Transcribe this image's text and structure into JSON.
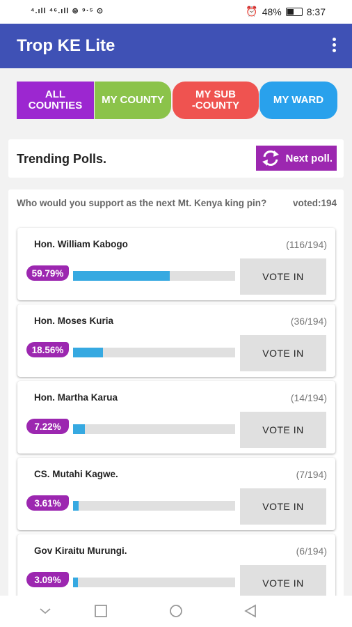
{
  "status_bar": {
    "left": "⁴.ıll ⁴⁶.ıll ⊚ ⁹·⁵ ⊙",
    "battery": "48%",
    "time": "8:37"
  },
  "app": {
    "title": "Trop KE Lite"
  },
  "filters": [
    {
      "label": "ALL\nCOUNTIES"
    },
    {
      "label": "MY COUNTY"
    },
    {
      "label": "MY SUB\n-COUNTY"
    },
    {
      "label": "MY WARD"
    }
  ],
  "trending": {
    "title": "Trending Polls.",
    "next_label": "Next poll."
  },
  "poll": {
    "question": "Who would you support as the next Mt. Kenya king pin?",
    "voted": "voted:194",
    "vote_label": "VOTE IN",
    "candidates": [
      {
        "name": "Hon. William Kabogo",
        "count": "(116/194)",
        "percent": "59.79%",
        "fraction": 0.5979
      },
      {
        "name": "Hon. Moses Kuria",
        "count": "(36/194)",
        "percent": "18.56%",
        "fraction": 0.1856
      },
      {
        "name": "Hon. Martha Karua",
        "count": "(14/194)",
        "percent": "7.22%",
        "fraction": 0.0722
      },
      {
        "name": "CS. Mutahi Kagwe.",
        "count": "(7/194)",
        "percent": "3.61%",
        "fraction": 0.0361
      },
      {
        "name": "Gov Kiraitu Murungi.",
        "count": "(6/194)",
        "percent": "3.09%",
        "fraction": 0.0309
      }
    ]
  },
  "nav_icons": [
    "chevron-down-icon",
    "square-icon",
    "circle-icon",
    "back-triangle-icon"
  ],
  "colors": {
    "appbar": "#3f51b5",
    "accent_purple": "#9c27b0",
    "bar_fill": "#36a9e1"
  }
}
